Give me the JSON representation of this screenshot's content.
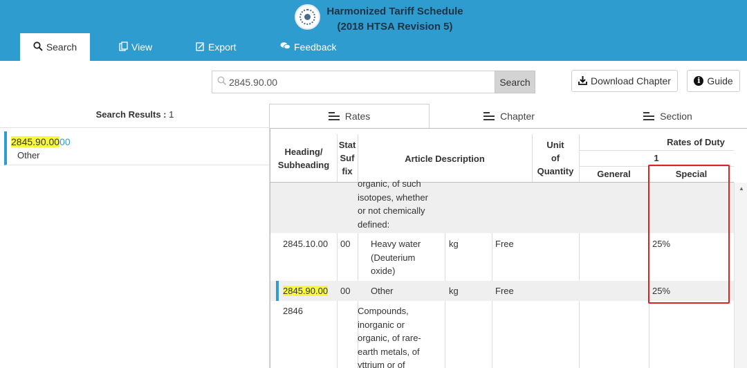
{
  "header": {
    "title_line1": "Harmonized Tariff Schedule",
    "title_line2": "(2018 HTSA Revision 5)"
  },
  "nav": {
    "tabs": [
      {
        "label": "Search",
        "icon": "search-icon"
      },
      {
        "label": "View",
        "icon": "view-icon"
      },
      {
        "label": "Export",
        "icon": "export-icon"
      },
      {
        "label": "Feedback",
        "icon": "feedback-icon"
      }
    ]
  },
  "search": {
    "value": "2845.90.00",
    "button_label": "Search"
  },
  "toolbar": {
    "download_label": "Download Chapter",
    "guide_label": "Guide"
  },
  "results": {
    "title": "Search Results :",
    "count": "1",
    "items": [
      {
        "code": "2845.90.00",
        "suffix": "00",
        "description": "Other"
      }
    ]
  },
  "view_tabs": [
    {
      "label": "Rates"
    },
    {
      "label": "Chapter"
    },
    {
      "label": "Section"
    }
  ],
  "table": {
    "headers": {
      "heading_line1": "Heading/",
      "heading_line2": "Subheading",
      "stat_line1": "Stat",
      "stat_line2": "Suf",
      "stat_line3": "fix",
      "article": "Article Description",
      "unit_line1": "Unit",
      "unit_line2": "of",
      "unit_line3": "Quantity",
      "rates": "Rates of Duty",
      "rates_col": "1",
      "general": "General",
      "special": "Special"
    },
    "rows": [
      {
        "heading": "",
        "stat": "",
        "description_lines": [
          "organic, of such",
          "isotopes, whether",
          "or not chemically",
          "defined:"
        ],
        "unit": "",
        "general": "",
        "special": ""
      },
      {
        "heading": "2845.10.00",
        "stat": "00",
        "description_lines": [
          "Heavy water",
          "(Deuterium",
          "oxide)"
        ],
        "unit": "kg",
        "general": "Free",
        "special": "25%"
      },
      {
        "heading": "2845.90.00",
        "stat": "00",
        "description_lines": [
          "Other"
        ],
        "unit": "kg",
        "general": "Free",
        "special": "25%"
      },
      {
        "heading": "2846",
        "stat": "",
        "description_lines": [
          "Compounds,",
          "inorganic or",
          "organic, of rare-",
          "earth metals, of",
          "yttrium or of"
        ],
        "unit": "",
        "general": "",
        "special": ""
      }
    ]
  },
  "colors": {
    "brand_blue": "#2e9ccf",
    "highlight": "#f7f73e",
    "annotation_red": "#e02020"
  }
}
